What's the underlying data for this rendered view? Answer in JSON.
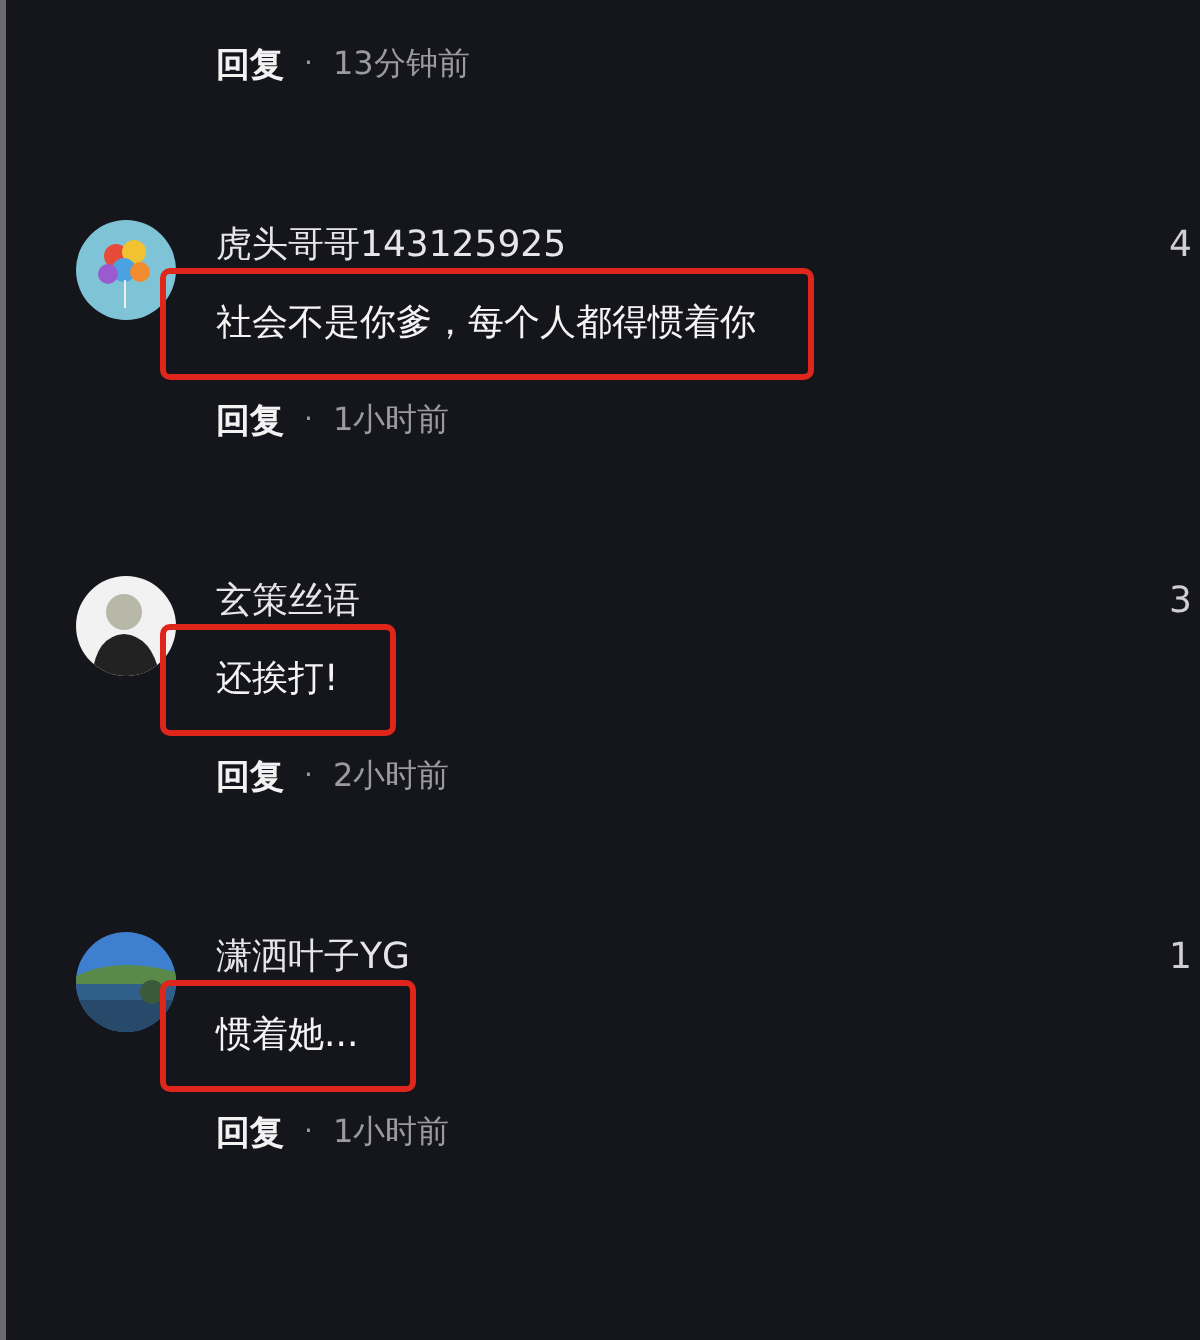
{
  "top_reply": {
    "reply": "回复",
    "dot": "·",
    "time": "13分钟前"
  },
  "comments": [
    {
      "name": "虎头哥哥143125925",
      "count": "4",
      "text": "社会不是你爹，每个人都得惯着你",
      "highlighted": true,
      "reply": "回复",
      "dot": "·",
      "time": "1小时前"
    },
    {
      "name": "玄策丝语",
      "count": "3",
      "text": "还挨打!",
      "highlighted": true,
      "reply": "回复",
      "dot": "·",
      "time": "2小时前"
    },
    {
      "name": "潇洒叶子YG",
      "count": "1",
      "text": "惯着她...",
      "highlighted": true,
      "reply": "回复",
      "dot": "·",
      "time": "1小时前"
    }
  ]
}
